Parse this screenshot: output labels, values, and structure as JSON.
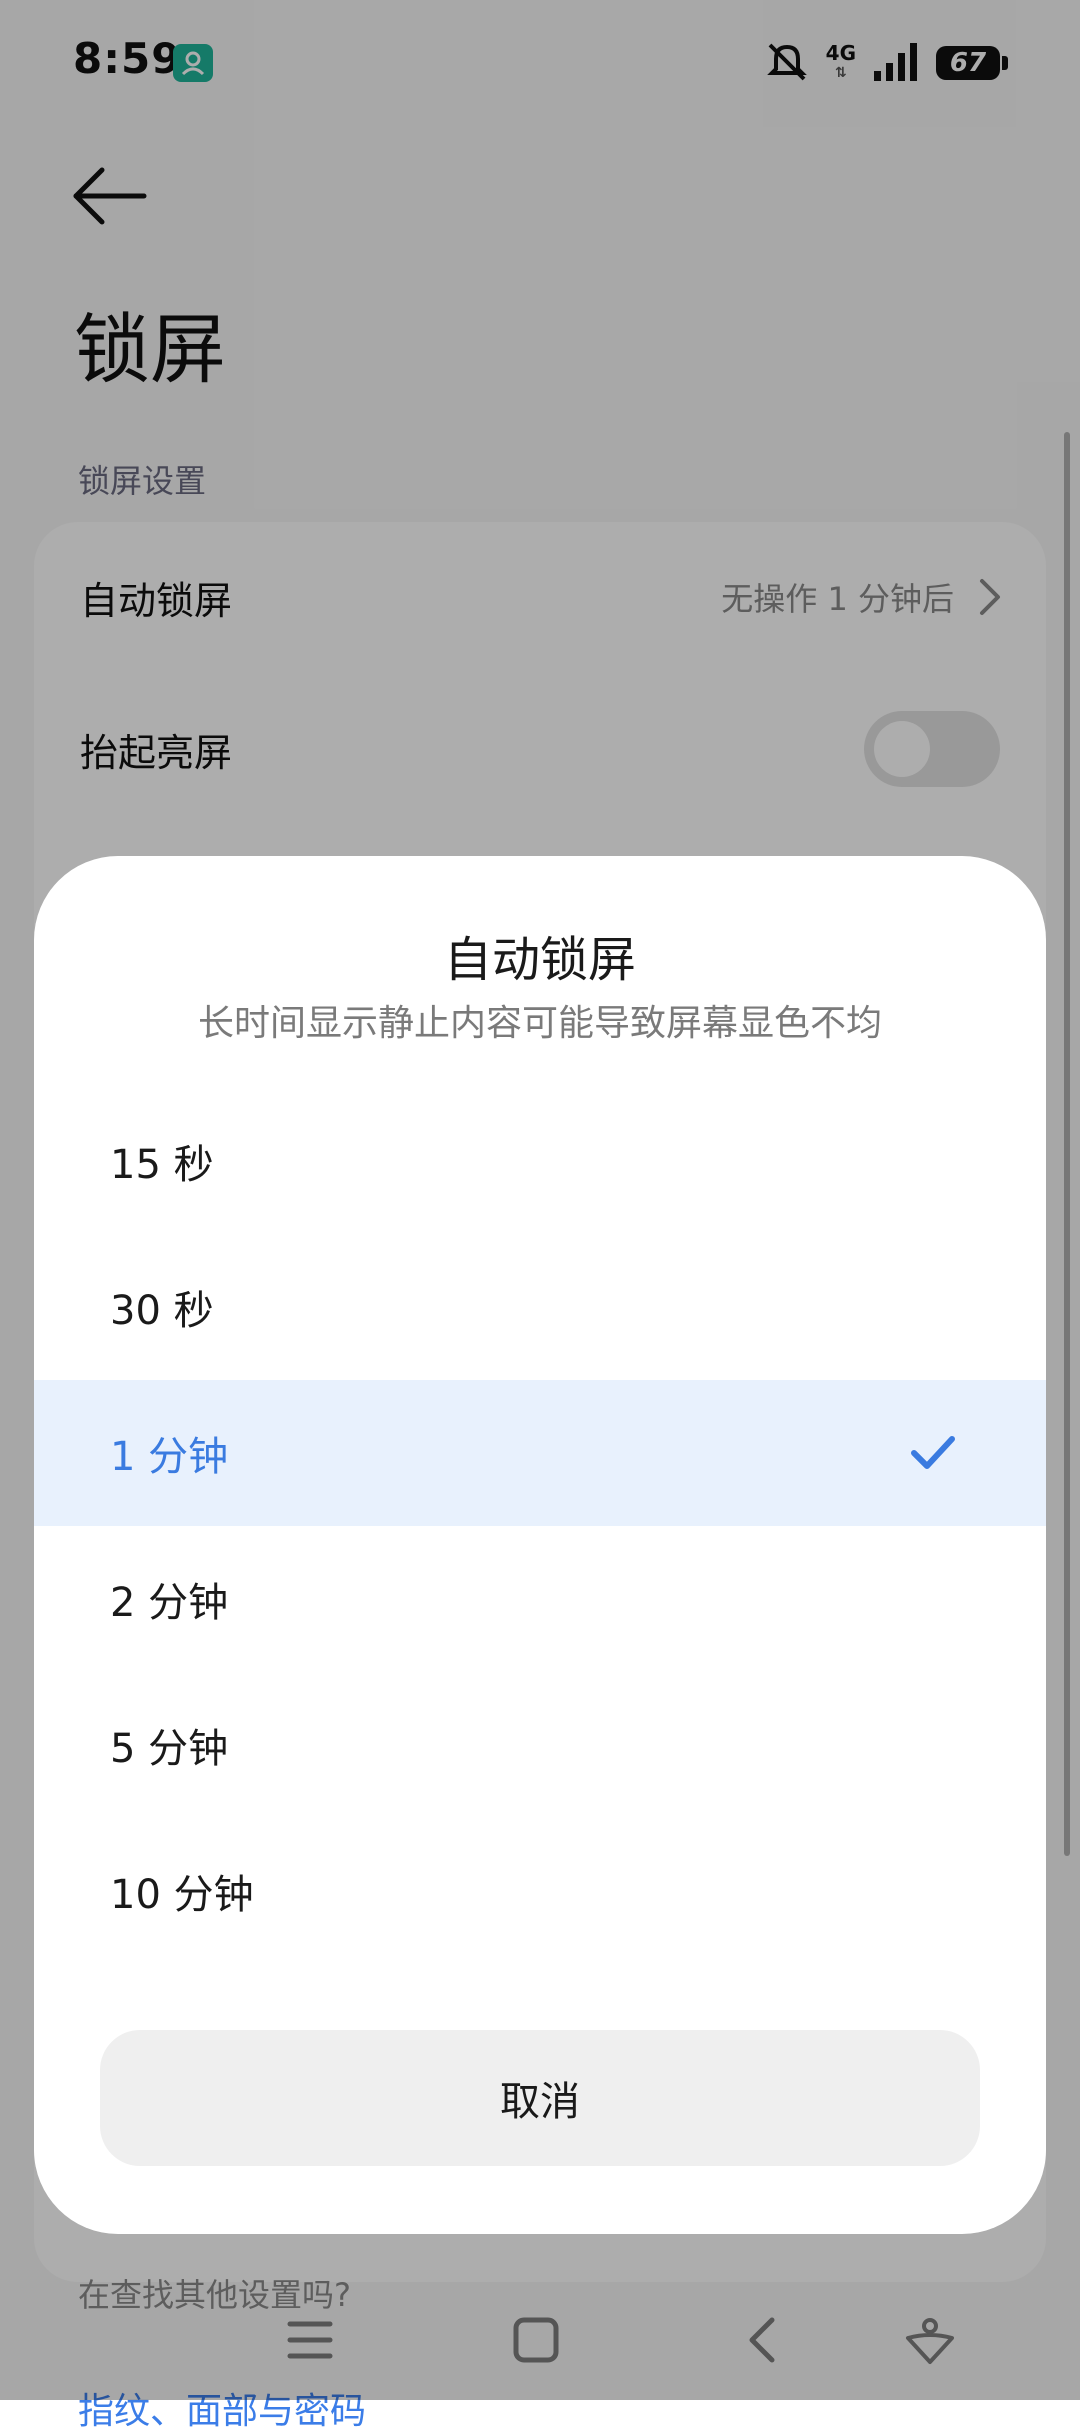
{
  "status_bar": {
    "time": "8:59",
    "network": "4G",
    "battery": "67"
  },
  "page": {
    "title": "锁屏",
    "section_header": "锁屏设置",
    "rows": [
      {
        "label": "自动锁屏",
        "value": "无操作 1 分钟后"
      },
      {
        "label": "抬起亮屏",
        "toggle_on": false
      }
    ],
    "search_hint": "在查找其他设置吗?",
    "bottom_link": "指纹、面部与密码"
  },
  "dialog": {
    "title": "自动锁屏",
    "subtitle": "长时间显示静止内容可能导致屏幕显色不均",
    "options": [
      {
        "label": "15 秒",
        "selected": false
      },
      {
        "label": "30 秒",
        "selected": false
      },
      {
        "label": "1 分钟",
        "selected": true
      },
      {
        "label": "2 分钟",
        "selected": false
      },
      {
        "label": "5 分钟",
        "selected": false
      },
      {
        "label": "10 分钟",
        "selected": false
      }
    ],
    "cancel_label": "取消"
  },
  "colors": {
    "accent": "#3a7be0",
    "selected_bg": "#e8f1fd",
    "app_icon": "#20b49a"
  },
  "icons": {
    "back": "arrow-left-icon",
    "chevron": "chevron-right-icon",
    "check": "check-icon",
    "nav": [
      "menu-icon",
      "home-icon",
      "back-icon",
      "assistant-icon"
    ]
  }
}
